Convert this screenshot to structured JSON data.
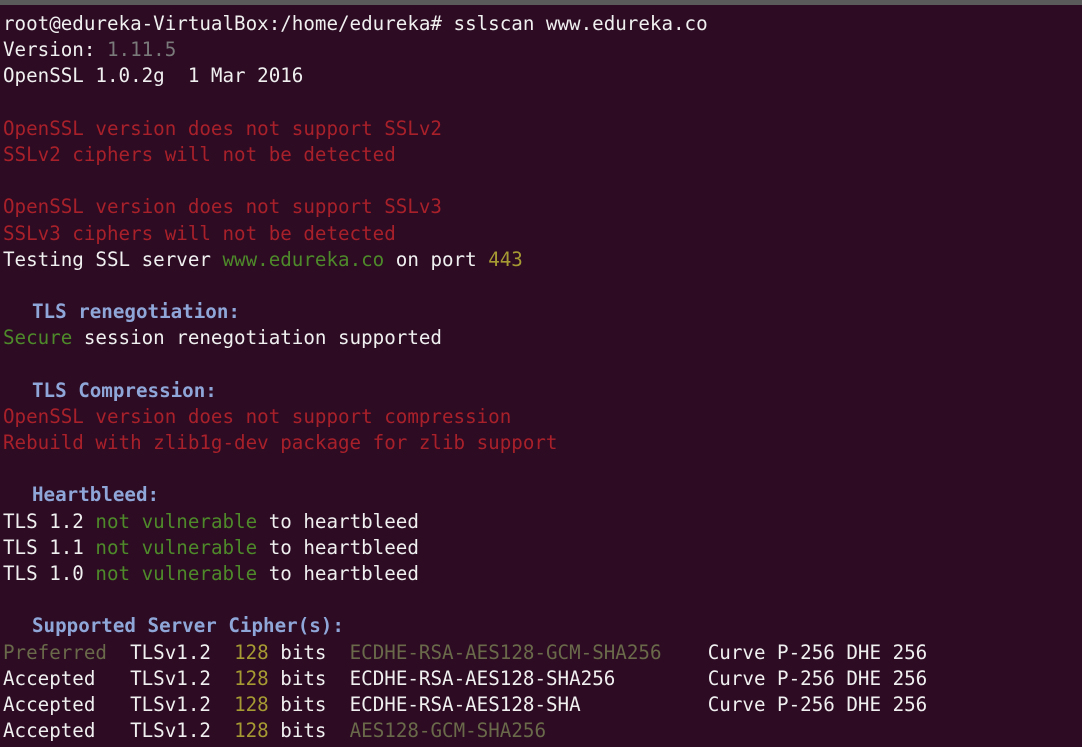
{
  "prompt": "root@edureka-VirtualBox:/home/edureka# sslscan www.edureka.co",
  "version_label": "Version: ",
  "version_value": "1.11.5",
  "openssl_line": "OpenSSL 1.0.2g  1 Mar 2016",
  "sslv2_warning_1": "OpenSSL version does not support SSLv2",
  "sslv2_warning_2": "SSLv2 ciphers will not be detected",
  "sslv3_warning_1": "OpenSSL version does not support SSLv3",
  "sslv3_warning_2": "SSLv3 ciphers will not be detected",
  "testing": {
    "prefix": "Testing SSL server ",
    "host": "www.edureka.co",
    "middle": " on port ",
    "port": "443"
  },
  "tls_renegotiation": {
    "heading": "TLS renegotiation:",
    "status": "Secure",
    "rest": " session renegotiation supported"
  },
  "tls_compression": {
    "heading": "TLS Compression:",
    "line1": "OpenSSL version does not support compression",
    "line2": "Rebuild with zlib1g-dev package for zlib support"
  },
  "heartbleed": {
    "heading": "Heartbleed:",
    "rows": [
      {
        "proto": "TLS 1.2 ",
        "status": "not vulnerable",
        "rest": " to heartbleed"
      },
      {
        "proto": "TLS 1.1 ",
        "status": "not vulnerable",
        "rest": " to heartbleed"
      },
      {
        "proto": "TLS 1.0 ",
        "status": "not vulnerable",
        "rest": " to heartbleed"
      }
    ]
  },
  "ciphers": {
    "heading": "Supported Server Cipher(s):",
    "rows": [
      {
        "status": "Preferred",
        "proto": "TLSv1.2",
        "bits": "128",
        "bits_label": "bits",
        "cipher": "ECDHE-RSA-AES128-GCM-SHA256",
        "curve": "Curve P-256 DHE 256"
      },
      {
        "status": "Accepted",
        "proto": "TLSv1.2",
        "bits": "128",
        "bits_label": "bits",
        "cipher": "ECDHE-RSA-AES128-SHA256",
        "curve": "Curve P-256 DHE 256"
      },
      {
        "status": "Accepted",
        "proto": "TLSv1.2",
        "bits": "128",
        "bits_label": "bits",
        "cipher": "ECDHE-RSA-AES128-SHA",
        "curve": "Curve P-256 DHE 256"
      },
      {
        "status": "Accepted",
        "proto": "TLSv1.2",
        "bits": "128",
        "bits_label": "bits",
        "cipher": "AES128-GCM-SHA256",
        "curve": ""
      }
    ]
  },
  "colors": {
    "background": "#2c0b23",
    "text": "#f0f0f0",
    "heading": "#8fa6d8",
    "warning": "#a8202a",
    "good": "#4e8a2a",
    "value": "#a69a33"
  }
}
